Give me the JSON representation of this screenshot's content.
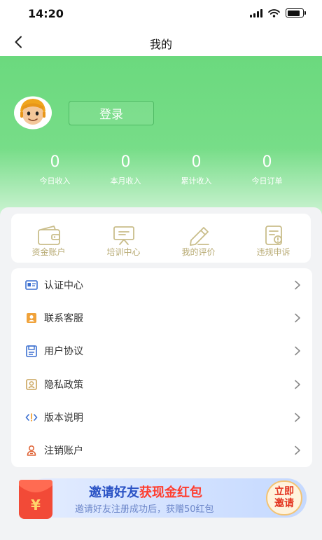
{
  "status_bar": {
    "time": "14:20",
    "battery_level": 0.85,
    "icons": [
      "signal-icon",
      "wifi-icon",
      "battery-icon"
    ]
  },
  "nav": {
    "title": "我的",
    "back_icon": "chevron-left-icon"
  },
  "profile": {
    "avatar_icon": "avatar-cartoon",
    "login_label": "登录"
  },
  "stats": [
    {
      "value": "0",
      "label": "今日收入"
    },
    {
      "value": "0",
      "label": "本月收入"
    },
    {
      "value": "0",
      "label": "累计收入"
    },
    {
      "value": "0",
      "label": "今日订单"
    }
  ],
  "quick_actions": [
    {
      "label": "资金账户",
      "icon": "wallet-icon"
    },
    {
      "label": "培训中心",
      "icon": "presentation-board-icon"
    },
    {
      "label": "我的评价",
      "icon": "edit-pencil-icon"
    },
    {
      "label": "违规申诉",
      "icon": "document-alert-icon"
    }
  ],
  "menu": [
    {
      "label": "认证中心",
      "icon": "id-card-icon"
    },
    {
      "label": "联系客服",
      "icon": "contact-card-icon"
    },
    {
      "label": "用户协议",
      "icon": "agreement-icon"
    },
    {
      "label": "隐私政策",
      "icon": "privacy-icon"
    },
    {
      "label": "版本说明",
      "icon": "version-icon"
    },
    {
      "label": "注销账户",
      "icon": "user-remove-icon"
    }
  ],
  "banner": {
    "title_prefix": "邀请好友",
    "title_highlight": "获现金红包",
    "subtitle": "邀请好友注册成功后，获赠50红包",
    "envelope_symbol": "¥",
    "button_line1": "立即",
    "button_line2": "邀请"
  },
  "colors": {
    "primary_green": "#6bd97e",
    "gold": "#b8ab74",
    "banner_blue": "#2b53c5",
    "highlight_red": "#ff3d2e"
  }
}
